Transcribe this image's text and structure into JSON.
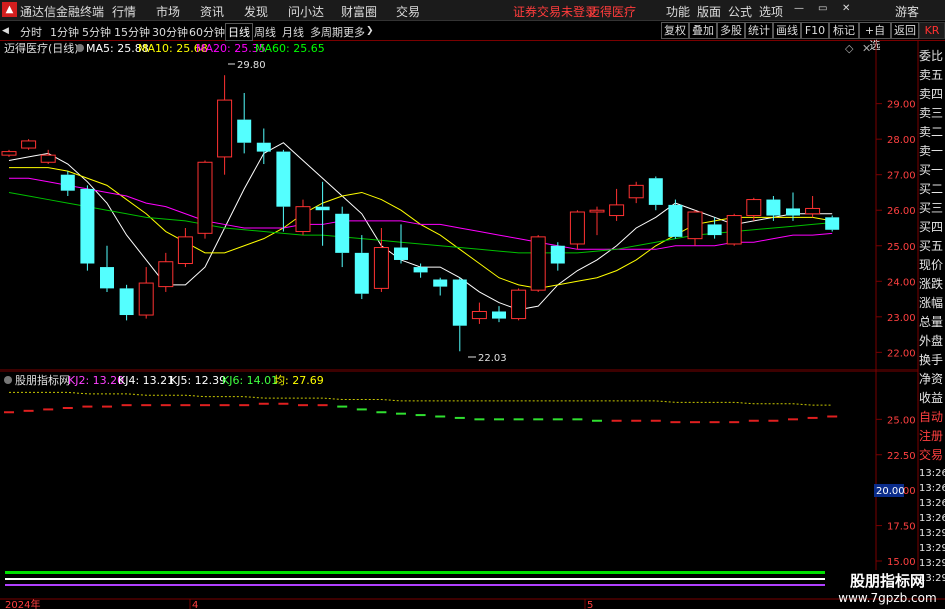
{
  "menubar": {
    "app_name": "通达信金融终端",
    "menus": [
      "行情",
      "市场",
      "资讯",
      "发现",
      "问小达",
      "财富圈",
      "交易"
    ],
    "status": "证券交易未登录",
    "stock": "迈得医疗",
    "right_menus": [
      "功能",
      "版面",
      "公式",
      "选项"
    ],
    "user": "游客"
  },
  "toolbar": {
    "periods": [
      "分时",
      "1分钟",
      "5分钟",
      "15分钟",
      "30分钟",
      "60分钟",
      "日线",
      "周线",
      "月线",
      "多周期",
      "更多"
    ],
    "active_period": "日线",
    "buttons": [
      "复权",
      "叠加",
      "多股",
      "统计",
      "画线",
      "F10",
      "标记",
      "+自选",
      "返回"
    ],
    "market_tag": "KR"
  },
  "main_chart": {
    "title": "迈得医疗(日线)",
    "ma": [
      {
        "label": "MA5: 25.88",
        "color": "#ffffff"
      },
      {
        "label": "MA10: 25.68",
        "color": "#ffff00"
      },
      {
        "label": "MA20: 25.35",
        "color": "#ff00ff"
      },
      {
        "label": "MA60: 25.65",
        "color": "#00ff00"
      }
    ],
    "high_label": "29.80",
    "low_label": "22.03",
    "ticks": [
      "29.00",
      "28.00",
      "27.00",
      "26.00",
      "25.00",
      "24.00",
      "23.00",
      "22.00"
    ]
  },
  "sub_chart": {
    "title": "股朋指标网",
    "kj": [
      {
        "label": "KJ2: 13.20",
        "color": "#ff40ff"
      },
      {
        "label": "KJ4: 13.21",
        "color": "#ffffff"
      },
      {
        "label": "KJ5: 12.39",
        "color": "#ffffff"
      },
      {
        "label": "KJ6: 14.01",
        "color": "#40ff40"
      },
      {
        "label": "均: 27.69",
        "color": "#ffff00"
      }
    ],
    "ticks": [
      "25.00",
      "22.50",
      "20.00",
      "17.50",
      "15.00"
    ],
    "current_value": "20.00"
  },
  "date_axis": {
    "labels": [
      "2024年",
      "4",
      "5"
    ]
  },
  "right_panel": {
    "items": [
      "委比",
      "卖五",
      "卖四",
      "卖三",
      "卖二",
      "卖一",
      "买一",
      "买二",
      "买三",
      "买四",
      "买五",
      "现价",
      "涨跌",
      "涨幅",
      "总量",
      "外盘",
      "换手",
      "净资",
      "收益",
      "自动",
      "注册",
      "交易",
      "13:26",
      "13:26",
      "13:26",
      "13:26",
      "13:29",
      "13:29",
      "13:29",
      "13:29"
    ]
  },
  "watermark": {
    "line1": "股朋指标网",
    "line2": "www.7gpzb.com"
  },
  "chart_data": {
    "type": "candlestick",
    "ylim": [
      21.7,
      30.2
    ],
    "candles": [
      {
        "o": 27.55,
        "c": 27.65,
        "h": 27.7,
        "l": 27.5
      },
      {
        "o": 27.75,
        "c": 27.95,
        "h": 28.0,
        "l": 27.7
      },
      {
        "o": 27.35,
        "c": 27.55,
        "h": 27.7,
        "l": 27.3
      },
      {
        "o": 27.0,
        "c": 26.55,
        "h": 27.1,
        "l": 26.4
      },
      {
        "o": 26.6,
        "c": 24.5,
        "h": 26.7,
        "l": 24.3
      },
      {
        "o": 24.4,
        "c": 23.8,
        "h": 25.0,
        "l": 23.7
      },
      {
        "o": 23.8,
        "c": 23.05,
        "h": 23.9,
        "l": 22.9
      },
      {
        "o": 23.05,
        "c": 23.95,
        "h": 24.4,
        "l": 22.95
      },
      {
        "o": 23.85,
        "c": 24.55,
        "h": 24.8,
        "l": 23.7
      },
      {
        "o": 24.5,
        "c": 25.25,
        "h": 25.5,
        "l": 24.4
      },
      {
        "o": 25.35,
        "c": 27.35,
        "h": 27.4,
        "l": 25.2
      },
      {
        "o": 27.5,
        "c": 29.1,
        "h": 29.8,
        "l": 27.0
      },
      {
        "o": 28.55,
        "c": 27.9,
        "h": 29.3,
        "l": 27.6
      },
      {
        "o": 27.9,
        "c": 27.65,
        "h": 28.3,
        "l": 27.3
      },
      {
        "o": 27.65,
        "c": 26.1,
        "h": 27.7,
        "l": 25.4
      },
      {
        "o": 25.4,
        "c": 26.1,
        "h": 26.3,
        "l": 25.3
      },
      {
        "o": 26.1,
        "c": 26.0,
        "h": 26.8,
        "l": 25.0
      },
      {
        "o": 25.9,
        "c": 24.8,
        "h": 26.1,
        "l": 24.4
      },
      {
        "o": 24.8,
        "c": 23.65,
        "h": 25.3,
        "l": 23.5
      },
      {
        "o": 23.8,
        "c": 24.95,
        "h": 25.5,
        "l": 23.7
      },
      {
        "o": 24.95,
        "c": 24.6,
        "h": 25.6,
        "l": 24.5
      },
      {
        "o": 24.4,
        "c": 24.25,
        "h": 24.5,
        "l": 24.1
      },
      {
        "o": 24.05,
        "c": 23.85,
        "h": 24.1,
        "l": 23.6
      },
      {
        "o": 24.05,
        "c": 22.75,
        "h": 24.1,
        "l": 22.03
      },
      {
        "o": 22.95,
        "c": 23.15,
        "h": 23.4,
        "l": 22.8
      },
      {
        "o": 23.15,
        "c": 22.95,
        "h": 23.3,
        "l": 22.85
      },
      {
        "o": 22.95,
        "c": 23.75,
        "h": 23.8,
        "l": 22.9
      },
      {
        "o": 23.75,
        "c": 25.25,
        "h": 25.3,
        "l": 23.7
      },
      {
        "o": 25.0,
        "c": 24.5,
        "h": 25.1,
        "l": 24.3
      },
      {
        "o": 25.05,
        "c": 25.95,
        "h": 26.0,
        "l": 24.9
      },
      {
        "o": 25.95,
        "c": 26.0,
        "h": 26.1,
        "l": 25.3
      },
      {
        "o": 25.85,
        "c": 26.15,
        "h": 26.6,
        "l": 25.7
      },
      {
        "o": 26.35,
        "c": 26.7,
        "h": 26.8,
        "l": 26.2
      },
      {
        "o": 26.9,
        "c": 26.15,
        "h": 26.95,
        "l": 26.0
      },
      {
        "o": 26.15,
        "c": 25.25,
        "h": 26.3,
        "l": 25.2
      },
      {
        "o": 25.2,
        "c": 25.95,
        "h": 26.0,
        "l": 25.0
      },
      {
        "o": 25.6,
        "c": 25.3,
        "h": 25.8,
        "l": 25.2
      },
      {
        "o": 25.05,
        "c": 25.85,
        "h": 25.9,
        "l": 25.0
      },
      {
        "o": 25.85,
        "c": 26.3,
        "h": 26.35,
        "l": 25.7
      },
      {
        "o": 26.3,
        "c": 25.85,
        "h": 26.4,
        "l": 25.7
      },
      {
        "o": 26.05,
        "c": 25.85,
        "h": 26.5,
        "l": 25.7
      },
      {
        "o": 25.9,
        "c": 26.05,
        "h": 26.4,
        "l": 25.8
      },
      {
        "o": 25.8,
        "c": 25.45,
        "h": 25.85,
        "l": 25.4
      }
    ],
    "ma5": [
      27.4,
      27.5,
      27.6,
      27.3,
      26.8,
      26.2,
      25.3,
      24.6,
      23.9,
      23.9,
      24.4,
      25.5,
      26.6,
      27.6,
      27.9,
      27.4,
      26.9,
      26.4,
      25.9,
      25.0,
      24.6,
      24.4,
      24.4,
      24.1,
      23.7,
      23.4,
      23.2,
      23.3,
      23.9,
      24.3,
      24.6,
      25.0,
      25.5,
      25.8,
      26.2,
      26.0,
      25.8,
      25.6,
      25.7,
      25.8,
      25.9,
      25.9,
      25.9
    ],
    "ma10": [
      27.2,
      27.2,
      27.2,
      27.1,
      26.9,
      26.7,
      26.3,
      25.9,
      25.4,
      25.1,
      24.8,
      24.8,
      25.0,
      25.2,
      25.5,
      25.9,
      26.2,
      26.4,
      26.5,
      26.3,
      26.0,
      25.6,
      25.3,
      24.9,
      24.5,
      24.1,
      23.9,
      23.8,
      23.9,
      24.0,
      24.1,
      24.3,
      24.6,
      25.0,
      25.3,
      25.6,
      25.7,
      25.8,
      25.8,
      25.8,
      25.8,
      25.8,
      25.7
    ],
    "ma20": [
      26.9,
      26.9,
      26.8,
      26.7,
      26.6,
      26.5,
      26.4,
      26.2,
      26.1,
      25.9,
      25.7,
      25.6,
      25.5,
      25.5,
      25.5,
      25.6,
      25.6,
      25.7,
      25.7,
      25.7,
      25.7,
      25.6,
      25.6,
      25.5,
      25.4,
      25.3,
      25.2,
      25.1,
      25.0,
      24.9,
      24.9,
      24.9,
      24.9,
      24.9,
      25.0,
      25.0,
      25.0,
      25.1,
      25.1,
      25.2,
      25.3,
      25.3,
      25.35
    ],
    "ma60": [
      26.5,
      26.4,
      26.3,
      26.2,
      26.1,
      26.0,
      25.9,
      25.8,
      25.75,
      25.7,
      25.6,
      25.5,
      25.45,
      25.4,
      25.35,
      25.3,
      25.3,
      25.25,
      25.2,
      25.15,
      25.1,
      25.05,
      25.0,
      24.95,
      24.9,
      24.85,
      24.8,
      24.8,
      24.8,
      24.8,
      24.85,
      24.9,
      25.0,
      25.1,
      25.2,
      25.3,
      25.35,
      25.4,
      25.45,
      25.5,
      25.55,
      25.6,
      25.65
    ],
    "sub_ylim": [
      15.0,
      27.0
    ],
    "sub_yellow": [
      26.9,
      26.9,
      26.9,
      26.9,
      26.8,
      26.8,
      26.8,
      26.7,
      26.7,
      26.7,
      26.6,
      26.6,
      26.6,
      26.5,
      26.5,
      26.5,
      26.5,
      26.4,
      26.4,
      26.4,
      26.3,
      26.3,
      26.3,
      26.3,
      26.3,
      26.3,
      26.3,
      26.3,
      26.3,
      26.3,
      26.3,
      26.3,
      26.3,
      26.3,
      26.2,
      26.2,
      26.2,
      26.2,
      26.1,
      26.1,
      26.1,
      26.0,
      26.0
    ],
    "sub_dash": [
      25.5,
      25.6,
      25.7,
      25.8,
      25.9,
      25.9,
      26.0,
      26.0,
      26.0,
      26.0,
      26.0,
      26.0,
      26.0,
      26.1,
      26.1,
      26.0,
      26.0,
      25.9,
      25.7,
      25.5,
      25.4,
      25.3,
      25.2,
      25.1,
      25.0,
      25.0,
      25.0,
      25.0,
      25.0,
      25.0,
      24.9,
      24.9,
      24.9,
      24.9,
      24.8,
      24.8,
      24.8,
      24.8,
      24.9,
      24.9,
      25.0,
      25.1,
      25.2
    ],
    "sub_dash_color": [
      "r",
      "r",
      "r",
      "r",
      "r",
      "r",
      "r",
      "r",
      "r",
      "r",
      "r",
      "r",
      "r",
      "r",
      "r",
      "r",
      "r",
      "g",
      "g",
      "g",
      "g",
      "g",
      "g",
      "g",
      "g",
      "g",
      "g",
      "g",
      "g",
      "g",
      "g",
      "r",
      "r",
      "r",
      "r",
      "r",
      "r",
      "r",
      "r",
      "r",
      "r",
      "r",
      "r"
    ]
  }
}
